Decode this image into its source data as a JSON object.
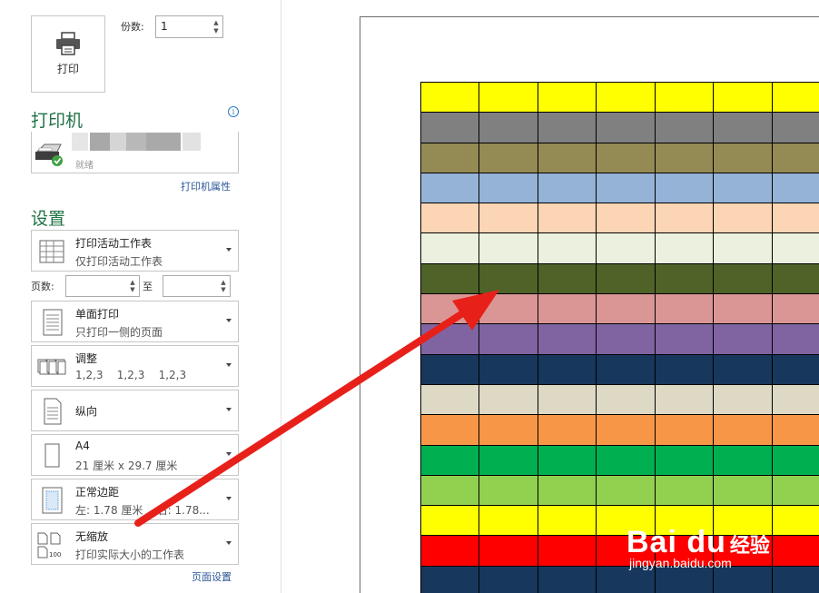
{
  "print": {
    "label": "打印"
  },
  "copies": {
    "label": "份数:",
    "value": "1"
  },
  "printer": {
    "title": "打印机",
    "status": "就绪",
    "properties_link": "打印机属性",
    "info_icon": "i"
  },
  "settings": {
    "title": "设置",
    "items": [
      {
        "icon": "grid-sheet-icon",
        "title": "打印活动工作表",
        "sub": "仅打印活动工作表"
      },
      {
        "icon": "single-side-icon",
        "title": "单面打印",
        "sub": "只打印一侧的页面"
      },
      {
        "icon": "collate-icon",
        "title": "调整",
        "sub": "1,2,3    1,2,3    1,2,3"
      },
      {
        "icon": "portrait-icon",
        "title": "纵向",
        "sub": ""
      },
      {
        "icon": "paper-size-icon",
        "title": "A4",
        "sub": "21 厘米 x 29.7 厘米"
      },
      {
        "icon": "margins-icon",
        "title": "正常边距",
        "sub": "左: 1.78 厘米    右: 1.78..."
      },
      {
        "icon": "scaling-icon",
        "title": "无缩放",
        "sub": "打印实际大小的工作表"
      }
    ],
    "pages_label": "页数:",
    "pages_to": "至",
    "page_setup_link": "页面设置"
  },
  "preview": {
    "row_colors": [
      "#FFFF00",
      "#808080",
      "#948A54",
      "#95B3D7",
      "#FCD5B4",
      "#EBF1DE",
      "#4F6228",
      "#DA9694",
      "#8064A2",
      "#17375D",
      "#DDD9C4",
      "#F79646",
      "#00B050",
      "#92D050",
      "#FFFF00",
      "#FF0000",
      "#17375D"
    ],
    "columns": 7
  },
  "watermark": {
    "logo": "Bai du",
    "text": "经验",
    "url": "jingyan.baidu.com"
  },
  "colors": {
    "accent_green": "#217346",
    "link_blue": "#2b5797",
    "arrow_red": "#e8201a"
  }
}
